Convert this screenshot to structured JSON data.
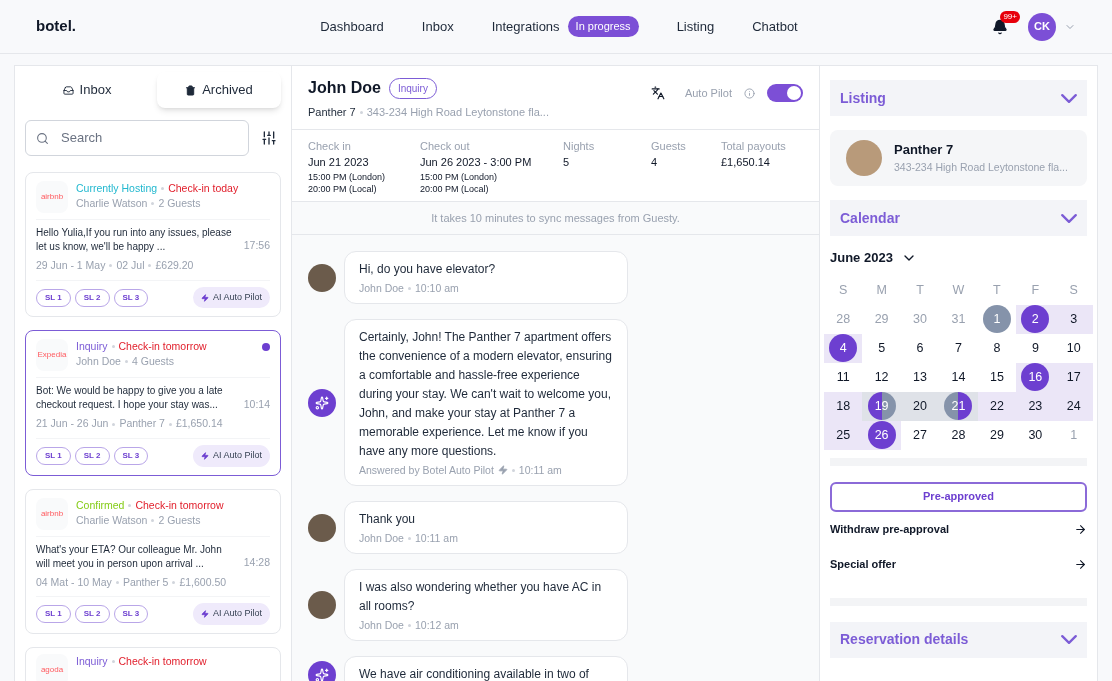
{
  "brand": "botel.",
  "nav": [
    {
      "label": "Dashboard"
    },
    {
      "label": "Inbox"
    },
    {
      "label": "Integrations",
      "badge": "In progress"
    },
    {
      "label": "Listing"
    },
    {
      "label": "Chatbot"
    }
  ],
  "notifications": {
    "count": "99+"
  },
  "user": {
    "initials": "CK"
  },
  "inbox_tabs": [
    {
      "label": "Inbox",
      "selected": false
    },
    {
      "label": "Archived",
      "selected": true
    }
  ],
  "search": {
    "placeholder": "Search"
  },
  "conversations": [
    {
      "logo": "airbnb",
      "status": {
        "text": "Currently Hosting",
        "color": "#22b8cf"
      },
      "checkin": "Check-in today",
      "guest": "Charlie Watson",
      "guests": "2 Guests",
      "message": "Hello Yulia,If you run into any issues, please let us know, we'll be happy ...",
      "time": "17:56",
      "meta": [
        "29 Jun - 1 May",
        "02 Jul",
        "£629.20"
      ],
      "tags": [
        "SL 1",
        "SL 2",
        "SL 3"
      ],
      "pilot": "AI Auto Pilot",
      "selected": false,
      "unread": false
    },
    {
      "logo": "Expedia",
      "status": {
        "text": "Inquiry",
        "color": "#7c5cd6"
      },
      "checkin": "Check-in tomorrow",
      "guest": "John Doe",
      "guests": "4 Guests",
      "message": "Bot: We would be happy to give you a  late checkout request. I hope your stay was...",
      "time": "10:14",
      "meta": [
        "21 Jun - 26 Jun",
        "Panther 7",
        "£1,650.14"
      ],
      "tags": [
        "SL 1",
        "SL 2",
        "SL 3"
      ],
      "pilot": "AI Auto Pilot",
      "selected": true,
      "unread": true
    },
    {
      "logo": "airbnb",
      "status": {
        "text": "Confirmed",
        "color": "#84cc16"
      },
      "checkin": "Check-in tomorrow",
      "guest": "Charlie Watson",
      "guests": "2 Guests",
      "message": "What's your ETA? Our colleague Mr. John will meet you in person upon arrival ...",
      "time": "14:28",
      "meta": [
        "04 Mat - 10 May",
        "Panther 5",
        "£1,600.50"
      ],
      "tags": [
        "SL 1",
        "SL 2",
        "SL 3"
      ],
      "pilot": "AI Auto Pilot",
      "selected": false,
      "unread": false
    },
    {
      "logo": "agoda",
      "status": {
        "text": "Inquiry",
        "color": "#7c5cd6"
      },
      "checkin": "Check-in tomorrow",
      "selected": false,
      "unread": false
    }
  ],
  "guest": {
    "name": "John Doe",
    "badge": "Inquiry",
    "listing": "Panther 7",
    "address": "343-234 High Road Leytonstone fla..."
  },
  "auto_pilot": {
    "label": "Auto Pilot",
    "on": true
  },
  "stay": [
    {
      "label": "Check in",
      "value": "Jun 21 2023",
      "lines": [
        "15:00 PM (London)",
        "20:00 PM (Local)"
      ]
    },
    {
      "label": "Check out",
      "value": "Jun 26 2023 - 3:00 PM",
      "lines": [
        "15:00 PM (London)",
        "20:00 PM (Local)"
      ]
    },
    {
      "label": "Nights",
      "value": "5"
    },
    {
      "label": "Guests",
      "value": "4"
    },
    {
      "label": "Total payouts",
      "value": "£1,650.14"
    }
  ],
  "sync_notice": "It takes 10 minutes to sync messages from Guesty.",
  "messages": [
    {
      "kind": "guest",
      "text": "Hi, do you have elevator?",
      "author": "John Doe",
      "time": "10:10 am"
    },
    {
      "kind": "bot",
      "text": "Certainly, John! The Panther 7 apartment offers the convenience of a modern elevator, ensuring a comfortable and hassle-free experience during your stay. We can't wait to welcome you, John, and make your stay at Panther 7 a memorable experience. Let me know if you have any more questions.",
      "author": "Answered by Botel Auto Pilot",
      "time": "10:11 am"
    },
    {
      "kind": "guest",
      "text": "Thank you",
      "author": "John Doe",
      "time": "10:11 am"
    },
    {
      "kind": "guest",
      "text": "I was also wondering whether you have AC in all rooms?",
      "author": "John Doe",
      "time": "10:12 am"
    },
    {
      "kind": "bot",
      "text": "We have air conditioning available in two of"
    }
  ],
  "sections": {
    "listing": "Listing",
    "calendar": "Calendar",
    "reservation": "Reservation details"
  },
  "listing": {
    "name": "Panther 7",
    "address": "343-234 High Road Leytonstone fla..."
  },
  "calendar": {
    "month": "June 2023",
    "weekdays": [
      "S",
      "M",
      "T",
      "W",
      "T",
      "F",
      "S"
    ],
    "weeks": [
      [
        {
          "d": "28",
          "muted": true,
          "kind": "plain",
          "stay": false,
          "blocked": false
        },
        {
          "d": "29",
          "muted": true,
          "kind": "plain",
          "stay": false,
          "blocked": false
        },
        {
          "d": "30",
          "muted": true,
          "kind": "plain",
          "stay": false,
          "blocked": false
        },
        {
          "d": "31",
          "muted": true,
          "kind": "plain",
          "stay": false,
          "blocked": false
        },
        {
          "d": "1",
          "muted": false,
          "kind": "blocked",
          "stay": false,
          "blocked": false
        },
        {
          "d": "2",
          "muted": false,
          "kind": "booked",
          "stay": true,
          "blocked": false
        },
        {
          "d": "3",
          "muted": false,
          "kind": "plain",
          "stay": true,
          "blocked": false
        }
      ],
      [
        {
          "d": "4",
          "muted": false,
          "kind": "booked",
          "stay": true,
          "blocked": false
        },
        {
          "d": "5",
          "muted": false,
          "kind": "plain",
          "stay": false,
          "blocked": false
        },
        {
          "d": "6",
          "muted": false,
          "kind": "plain",
          "stay": false,
          "blocked": false
        },
        {
          "d": "7",
          "muted": false,
          "kind": "plain",
          "stay": false,
          "blocked": false
        },
        {
          "d": "8",
          "muted": false,
          "kind": "plain",
          "stay": false,
          "blocked": false
        },
        {
          "d": "9",
          "muted": false,
          "kind": "plain",
          "stay": false,
          "blocked": false
        },
        {
          "d": "10",
          "muted": false,
          "kind": "plain",
          "stay": false,
          "blocked": false
        }
      ],
      [
        {
          "d": "11",
          "muted": false,
          "kind": "plain",
          "stay": false,
          "blocked": false
        },
        {
          "d": "12",
          "muted": false,
          "kind": "plain",
          "stay": false,
          "blocked": false
        },
        {
          "d": "13",
          "muted": false,
          "kind": "plain",
          "stay": false,
          "blocked": false
        },
        {
          "d": "14",
          "muted": false,
          "kind": "plain",
          "stay": false,
          "blocked": false
        },
        {
          "d": "15",
          "muted": false,
          "kind": "plain",
          "stay": false,
          "blocked": false
        },
        {
          "d": "16",
          "muted": false,
          "kind": "booked",
          "stay": true,
          "blocked": false
        },
        {
          "d": "17",
          "muted": false,
          "kind": "plain",
          "stay": true,
          "blocked": false
        }
      ],
      [
        {
          "d": "18",
          "muted": false,
          "kind": "plain",
          "stay": true,
          "blocked": false
        },
        {
          "d": "19",
          "muted": false,
          "kind": "changeover",
          "stay": false,
          "blocked": true
        },
        {
          "d": "20",
          "muted": false,
          "kind": "plain",
          "stay": false,
          "blocked": true
        },
        {
          "d": "21",
          "muted": false,
          "kind": "handover",
          "stay": false,
          "blocked": true
        },
        {
          "d": "22",
          "muted": false,
          "kind": "plain",
          "stay": true,
          "blocked": false
        },
        {
          "d": "23",
          "muted": false,
          "kind": "plain",
          "stay": true,
          "blocked": false
        },
        {
          "d": "24",
          "muted": false,
          "kind": "plain",
          "stay": true,
          "blocked": false
        }
      ],
      [
        {
          "d": "25",
          "muted": false,
          "kind": "plain",
          "stay": true,
          "blocked": false
        },
        {
          "d": "26",
          "muted": false,
          "kind": "booked",
          "stay": true,
          "blocked": false
        },
        {
          "d": "27",
          "muted": false,
          "kind": "plain",
          "stay": false,
          "blocked": false
        },
        {
          "d": "28",
          "muted": false,
          "kind": "plain",
          "stay": false,
          "blocked": false
        },
        {
          "d": "29",
          "muted": false,
          "kind": "plain",
          "stay": false,
          "blocked": false
        },
        {
          "d": "30",
          "muted": false,
          "kind": "plain",
          "stay": false,
          "blocked": false
        },
        {
          "d": "1",
          "muted": true,
          "kind": "plain",
          "stay": false,
          "blocked": false
        }
      ]
    ]
  },
  "pre_approved": "Pre-approved",
  "actions": [
    "Withdraw pre-approval",
    "Special offer"
  ]
}
